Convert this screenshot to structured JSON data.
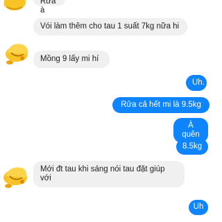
{
  "messages": [
    {
      "from": "them",
      "text": "Rửa à"
    },
    {
      "from": "them",
      "text": "Vói làm thêm cho tau 1 suất 7kg nữa hi"
    },
    {
      "from": "them",
      "text": "Mồng 9 lấy mi hí"
    },
    {
      "from": "me",
      "text": "Uh."
    },
    {
      "from": "me",
      "text": "Rửa cả hết mi là 9.5kg"
    },
    {
      "from": "me",
      "text": "À quên"
    },
    {
      "from": "me",
      "text": "8.5kg"
    },
    {
      "from": "them",
      "text": "Mới đt tau khi sáng nói tau đặt giúp với"
    },
    {
      "from": "me",
      "text": "Uh"
    }
  ],
  "avatar_icon": "cartoon-character-sticker-icon",
  "colors": {
    "outgoing_bubble": "#0f84ff",
    "incoming_bubble": "#f1f0f0",
    "incoming_text": "#1c1e21"
  }
}
